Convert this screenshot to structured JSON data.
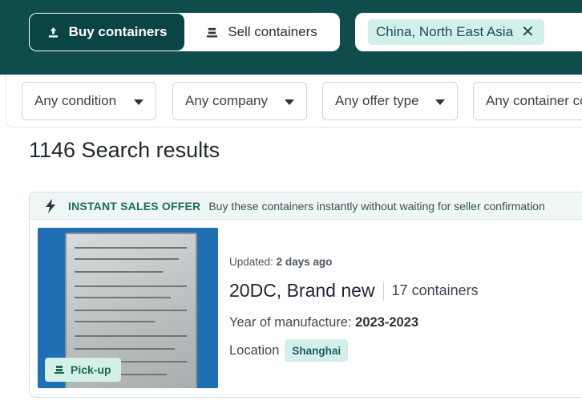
{
  "toggle": {
    "buy_label": "Buy containers",
    "sell_label": "Sell containers"
  },
  "search": {
    "chip_label": "China, North East Asia"
  },
  "filters": [
    {
      "label": "Any condition"
    },
    {
      "label": "Any company"
    },
    {
      "label": "Any offer type"
    },
    {
      "label": "Any container co"
    }
  ],
  "results": {
    "title": "1146 Search results"
  },
  "listing": {
    "offer_title": "INSTANT SALES OFFER",
    "offer_text": "Buy these containers instantly without waiting for seller confirmation",
    "pickup_label": "Pick-up",
    "updated_prefix": "Updated:",
    "updated_value": "2 days ago",
    "title": "20DC, Brand new",
    "count": "17",
    "count_label": "containers",
    "yom_label": "Year of manufacture:",
    "yom_value": "2023-2023",
    "location_label": "Location",
    "location_value": "Shanghai"
  },
  "colors": {
    "header_bg": "#0f4c4c",
    "accent": "#0b4444",
    "chip_bg": "#d3efec"
  }
}
